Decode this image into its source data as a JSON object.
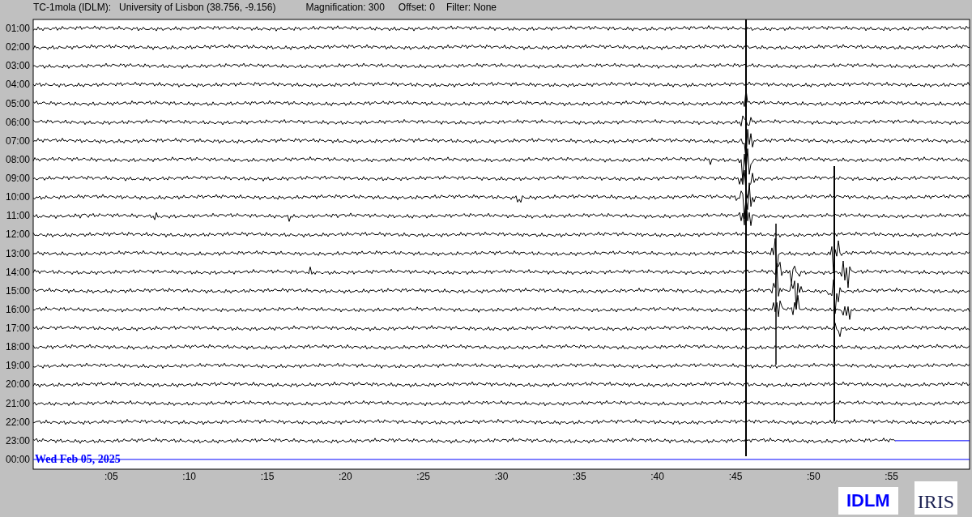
{
  "header": {
    "station": "TC-1mola (IDLM):",
    "location": "University of Lisbon (38.756, -9.156)",
    "magnification": "Magnification: 300",
    "offset": "Offset: 0",
    "filter": "Filter: None"
  },
  "hour_labels": [
    "01:00",
    "02:00",
    "03:00",
    "04:00",
    "05:00",
    "06:00",
    "07:00",
    "08:00",
    "09:00",
    "10:00",
    "11:00",
    "12:00",
    "13:00",
    "14:00",
    "15:00",
    "16:00",
    "17:00",
    "18:00",
    "19:00",
    "20:00",
    "21:00",
    "22:00",
    "23:00",
    "00:00"
  ],
  "minute_ticks": [
    ":05",
    ":10",
    ":15",
    ":20",
    ":25",
    ":30",
    ":35",
    ":40",
    ":45",
    ":50",
    ":55"
  ],
  "date": "Wed Feb 05, 2025",
  "logos": {
    "station": "IDLM",
    "network": "IRIS"
  }
}
